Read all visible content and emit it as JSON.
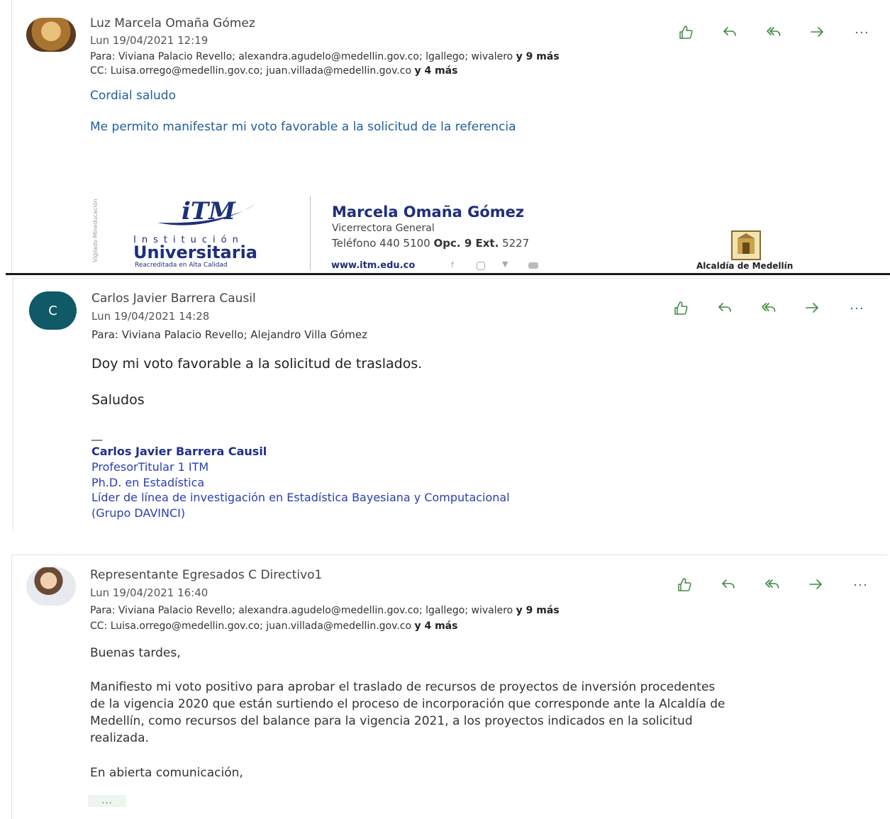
{
  "messages": [
    {
      "sender": "Luz Marcela Omaña Gómez",
      "date": "Lun 19/04/2021 12:19",
      "to_label": "Para:",
      "to": "Viviana Palacio Revello; alexandra.agudelo@medellin.gov.co; lgallego; wivalero",
      "to_more": "y 9 más",
      "cc_label": "CC:",
      "cc": "Luisa.orrego@medellin.gov.co; juan.villada@medellin.gov.co",
      "cc_more": "y 4 más",
      "body": [
        "Cordial saludo",
        "Me permito manifestar mi voto favorable a la solicitud de la referencia"
      ],
      "signature": {
        "logo_text_itm": "iTM",
        "logo_institucion": "Institución",
        "logo_universitaria": "Universitaria",
        "logo_reacreditada": "Reacreditada en Alta Calidad",
        "logo_side": "Vigilado Mineducación",
        "name": "Marcela Omaña Gómez",
        "role": "Vicerrectora General",
        "phone_label": "Teléfono 440 5100",
        "phone_opc": "Opc. 9 Ext.",
        "phone_ext": "5227",
        "web": "www.itm.edu.co",
        "alcaldia": "Alcaldía de Medellín"
      }
    },
    {
      "sender": "Carlos Javier Barrera Causil",
      "avatar_initial": "C",
      "date": "Lun 19/04/2021 14:28",
      "to_label": "Para:",
      "to": "Viviana Palacio Revello; Alejandro Villa Gómez",
      "body": [
        "Doy mi voto favorable a la solicitud de traslados.",
        "Saludos"
      ],
      "signature": {
        "dash": "__",
        "name": "Carlos Javier Barrera Causil",
        "lines": [
          "ProfesorTitular 1 ITM",
          "Ph.D. en Estadística",
          "Líder de línea de investigación en Estadística Bayesiana y Computacional",
          "(Grupo DAVINCI)"
        ]
      }
    },
    {
      "sender": "Representante Egresados C Directivo1",
      "date": "Lun 19/04/2021 16:40",
      "to_label": "Para:",
      "to": "Viviana Palacio Revello; alexandra.agudelo@medellin.gov.co; lgallego; wivalero",
      "to_more": "y 9 más",
      "cc_label": "CC:",
      "cc": "Luisa.orrego@medellin.gov.co; juan.villada@medellin.gov.co",
      "cc_more": "y 4 más",
      "body": [
        "Buenas tardes,",
        "Manifiesto mi voto positivo para aprobar el traslado de recursos de proyectos de inversión procedentes",
        "de la vigencia 2020 que están surtiendo el proceso de incorporación que corresponde ante la Alcaldía de",
        "Medellín, como recursos del balance para la vigencia 2021, a los proyectos indicados en la solicitud",
        "realizada.",
        "En abierta comunicación,"
      ],
      "more": "..."
    }
  ],
  "action_icons": [
    "like-icon",
    "reply-icon",
    "reply-all-icon",
    "forward-icon",
    "more-icon"
  ],
  "colors": {
    "accent_green": "#3f8a3f",
    "link_blue": "#1f5f9e",
    "signature_navy": "#1e2f7a",
    "avatar_teal": "#0f5a66"
  }
}
